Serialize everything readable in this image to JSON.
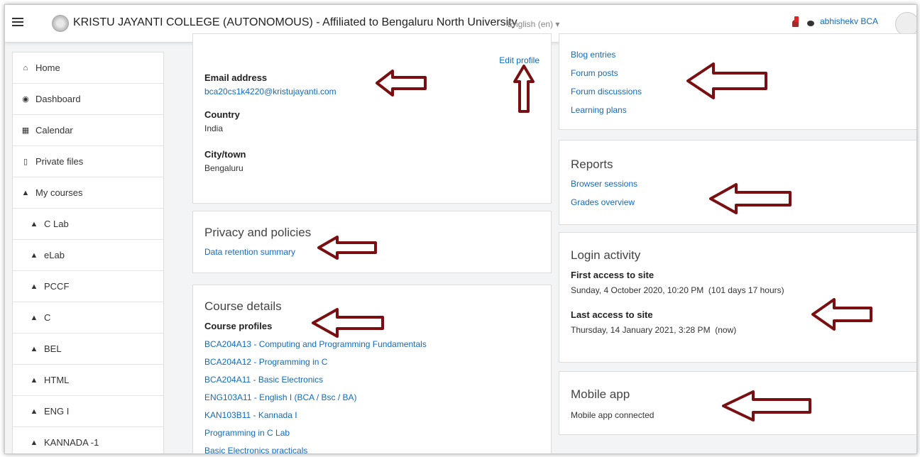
{
  "navbar": {
    "site_title": "KRISTU JAYANTI COLLEGE (AUTONOMOUS) - Affiliated to Bengaluru North University",
    "language": "English (en) ▾",
    "username": "abhishekv BCA"
  },
  "sidebar": {
    "items": [
      {
        "label": "Home",
        "icon": "home-icon"
      },
      {
        "label": "Dashboard",
        "icon": "dashboard-icon"
      },
      {
        "label": "Calendar",
        "icon": "calendar-icon"
      },
      {
        "label": "Private files",
        "icon": "file-icon"
      },
      {
        "label": "My courses",
        "icon": "graduation-cap-icon"
      },
      {
        "label": "C Lab",
        "icon": "graduation-cap-icon"
      },
      {
        "label": "eLab",
        "icon": "graduation-cap-icon"
      },
      {
        "label": "PCCF",
        "icon": "graduation-cap-icon"
      },
      {
        "label": "C",
        "icon": "graduation-cap-icon"
      },
      {
        "label": "BEL",
        "icon": "graduation-cap-icon"
      },
      {
        "label": "HTML",
        "icon": "graduation-cap-icon"
      },
      {
        "label": "ENG I",
        "icon": "graduation-cap-icon"
      },
      {
        "label": "KANNADA -1",
        "icon": "graduation-cap-icon"
      }
    ]
  },
  "user_details": {
    "edit_profile": "Edit profile",
    "email_label": "Email address",
    "email_value": "bca20cs1k4220@kristujayanti.com",
    "country_label": "Country",
    "country_value": "India",
    "city_label": "City/town",
    "city_value": "Bengaluru"
  },
  "privacy": {
    "title": "Privacy and policies",
    "link": "Data retention summary"
  },
  "course_details": {
    "title": "Course details",
    "subtitle": "Course profiles",
    "courses": [
      "BCA204A13 - Computing and Programming Fundamentals",
      "BCA204A12 - Programming in C",
      "BCA204A11 - Basic Electronics",
      "ENG103A11 - English I (BCA / Bsc / BA)",
      "KAN103B11 - Kannada I",
      "Programming in C Lab",
      "Basic Electronics practicals"
    ]
  },
  "miscellaneous": {
    "links": [
      "Blog entries",
      "Forum posts",
      "Forum discussions",
      "Learning plans"
    ]
  },
  "reports": {
    "title": "Reports",
    "links": [
      "Browser sessions",
      "Grades overview"
    ]
  },
  "login_activity": {
    "title": "Login activity",
    "first_label": "First access to site",
    "first_value": "Sunday, 4 October 2020, 10:20 PM  (101 days 17 hours)",
    "last_label": "Last access to site",
    "last_value": "Thursday, 14 January 2021, 3:28 PM  (now)"
  },
  "mobile_app": {
    "title": "Mobile app",
    "status": "Mobile app connected"
  },
  "colors": {
    "link": "#0f6cbf",
    "annotation_arrow": "#7a0f12"
  }
}
